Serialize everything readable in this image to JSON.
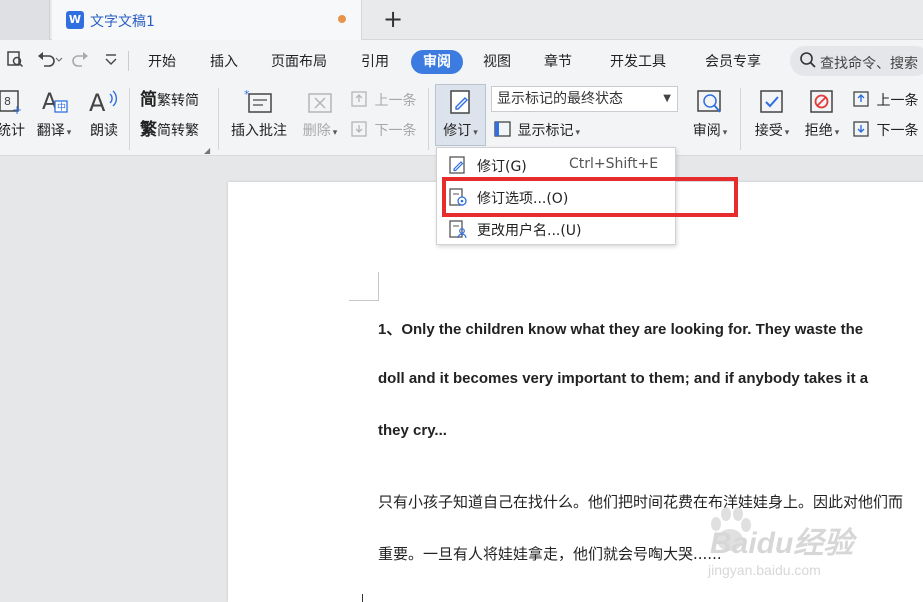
{
  "tab": {
    "title": "文字文稿1",
    "new_tab": "+"
  },
  "menu": {
    "items": [
      "开始",
      "插入",
      "页面布局",
      "引用",
      "审阅",
      "视图",
      "章节",
      "开发工具",
      "会员专享"
    ],
    "active": "审阅"
  },
  "search": {
    "placeholder": "查找命令、搜索"
  },
  "ribbon": {
    "count_label": "统计",
    "translate_label": "翻译",
    "read_aloud_label": "朗读",
    "trad_to_simp": "繁转简",
    "simp_to_trad": "简转繁",
    "insert_comment": "插入批注",
    "delete_label": "删除",
    "prev_comment": "上一条",
    "next_comment": "下一条",
    "track_label": "修订",
    "markup_select": "显示标记的最终状态",
    "show_markup": "显示标记",
    "review_label": "审阅",
    "accept_label": "接受",
    "reject_label": "拒绝",
    "prev_change": "上一条",
    "next_change": "下一条"
  },
  "dropdown": {
    "items": [
      {
        "label": "修订(G)",
        "shortcut": "Ctrl+Shift+E"
      },
      {
        "label": "修订选项...(O)",
        "shortcut": ""
      },
      {
        "label": "更改用户名...(U)",
        "shortcut": ""
      }
    ]
  },
  "document": {
    "en_line1": "1、Only the children know what they are looking for. They waste the",
    "en_line2": "doll and it becomes very important to them; and if anybody takes it a",
    "en_line3": "they cry...",
    "cn_line1": "只有小孩子知道自己在找什么。他们把时间花费在布洋娃娃身上。因此对他们而",
    "cn_line2": "重要。一旦有人将娃娃拿走，他们就会号啕大哭......"
  },
  "watermark": {
    "main": "Baidu经验",
    "sub": "jingyan.baidu.com"
  },
  "colors": {
    "accent": "#3c7ce0",
    "highlight": "#e62c2c",
    "modified_dot": "#e8944b"
  }
}
